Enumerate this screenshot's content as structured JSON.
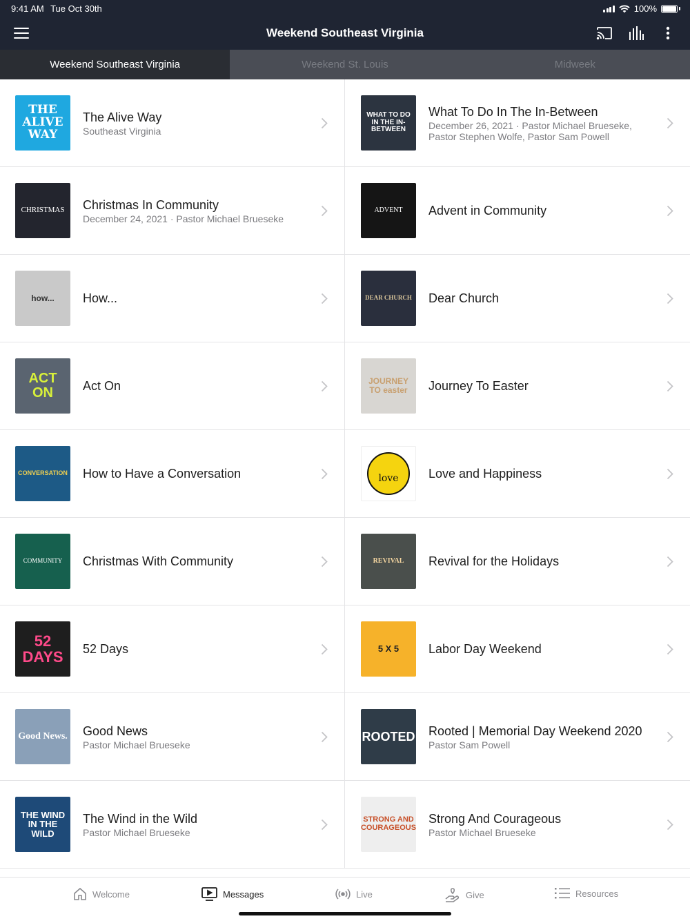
{
  "status_bar": {
    "time": "9:41 AM",
    "date": "Tue Oct 30th",
    "battery": "100%"
  },
  "header": {
    "title": "Weekend Southeast Virginia"
  },
  "tabs": [
    {
      "label": "Weekend Southeast Virginia",
      "active": true
    },
    {
      "label": "Weekend St. Louis",
      "active": false
    },
    {
      "label": "Midweek",
      "active": false
    }
  ],
  "series": [
    {
      "title": "The Alive Way",
      "subtitle": "Southeast Virginia",
      "thumb_text": "THE ALIVE WAY",
      "thumb_bg": "#1fa8e0"
    },
    {
      "title": "What To Do In The In-Between",
      "subtitle": "December 26, 2021 · Pastor Michael Brueseke, Pastor Stephen Wolfe, Pastor Sam Powell",
      "thumb_text": "WHAT TO DO IN THE IN-BETWEEN",
      "thumb_bg": "#2c3440"
    },
    {
      "title": "Christmas In Community",
      "subtitle": "December 24, 2021 · Pastor Michael Brueseke",
      "thumb_text": "CHRISTMAS",
      "thumb_bg": "#23252e"
    },
    {
      "title": "Advent in Community",
      "subtitle": "",
      "thumb_text": "ADVENT",
      "thumb_bg": "#151515"
    },
    {
      "title": "How...",
      "subtitle": "",
      "thumb_text": "how...",
      "thumb_bg": "#c9c9c9"
    },
    {
      "title": "Dear Church",
      "subtitle": "",
      "thumb_text": "DEAR CHURCH",
      "thumb_bg": "#2a2f3d"
    },
    {
      "title": "Act On",
      "subtitle": "",
      "thumb_text": "ACT ON",
      "thumb_bg": "#5a6470"
    },
    {
      "title": "Journey To Easter",
      "subtitle": "",
      "thumb_text": "JOURNEY TO easter",
      "thumb_bg": "#d8d6d2"
    },
    {
      "title": "How to Have a Conversation",
      "subtitle": "",
      "thumb_text": "CONVERSATION",
      "thumb_bg": "#1d5a86"
    },
    {
      "title": "Love and Happiness",
      "subtitle": "",
      "thumb_text": "love",
      "thumb_bg": "#ffffff"
    },
    {
      "title": "Christmas With Community",
      "subtitle": "",
      "thumb_text": "COMMUNITY",
      "thumb_bg": "#16604e"
    },
    {
      "title": "Revival for the Holidays",
      "subtitle": "",
      "thumb_text": "REVIVAL",
      "thumb_bg": "#4a4f4c"
    },
    {
      "title": "52 Days",
      "subtitle": "",
      "thumb_text": "52 DAYS",
      "thumb_bg": "#1e1e1e"
    },
    {
      "title": "Labor Day Weekend",
      "subtitle": "",
      "thumb_text": "5 X 5",
      "thumb_bg": "#f6b22a"
    },
    {
      "title": "Good News",
      "subtitle": "Pastor Michael Brueseke",
      "thumb_text": "Good News.",
      "thumb_bg": "#8aa0b8"
    },
    {
      "title": "Rooted | Memorial Day Weekend 2020",
      "subtitle": "Pastor Sam Powell",
      "thumb_text": "ROOTED",
      "thumb_bg": "#2f3c48"
    },
    {
      "title": "The Wind in the Wild",
      "subtitle": "Pastor Michael Brueseke",
      "thumb_text": "THE WIND IN THE WILD",
      "thumb_bg": "#1e4a78"
    },
    {
      "title": "Strong And Courageous",
      "subtitle": "Pastor Michael Brueseke",
      "thumb_text": "STRONG AND COURAGEOUS",
      "thumb_bg": "#eeeeee"
    }
  ],
  "bottom_nav": [
    {
      "label": "Welcome",
      "icon": "home-icon",
      "active": false
    },
    {
      "label": "Messages",
      "icon": "tv-play-icon",
      "active": true
    },
    {
      "label": "Live",
      "icon": "broadcast-icon",
      "active": false
    },
    {
      "label": "Give",
      "icon": "give-hand-icon",
      "active": false
    },
    {
      "label": "Resources",
      "icon": "list-icon",
      "active": false
    }
  ],
  "colors": {
    "header_bg": "#1f2533",
    "tab_bar_bg": "#4a4d55",
    "tab_active_bg": "#2a2d33"
  }
}
